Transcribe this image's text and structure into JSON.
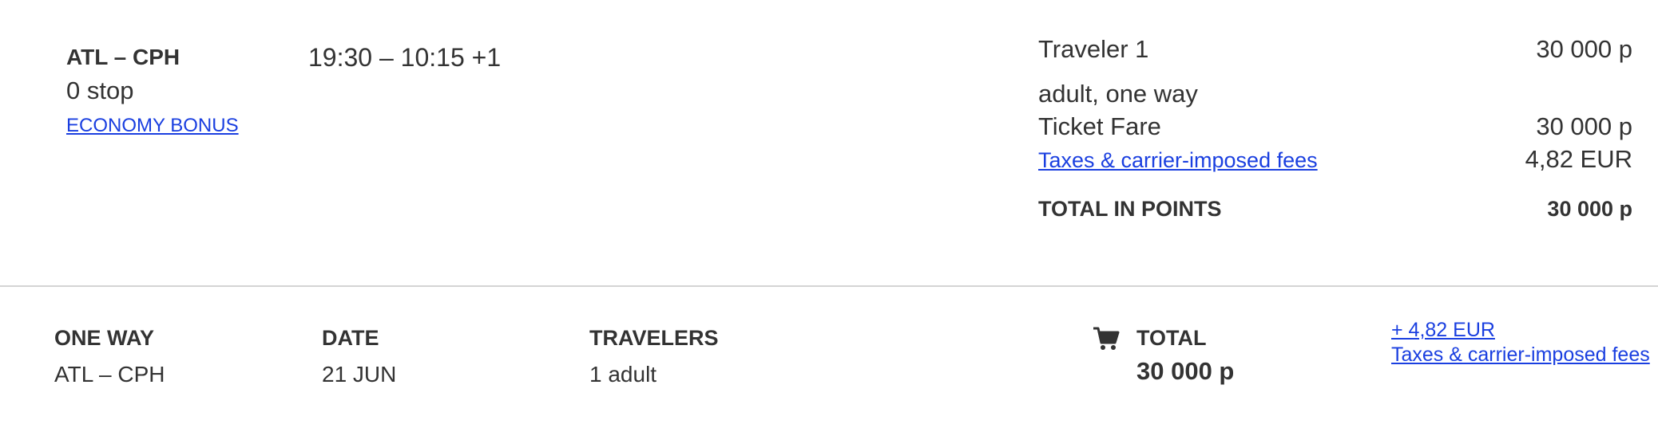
{
  "flight": {
    "route": "ATL – CPH",
    "stops": "0 stop",
    "fare_class": "ECONOMY BONUS",
    "times": "19:30 – 10:15 +1"
  },
  "price": {
    "traveler_label": "Traveler 1",
    "traveler_amount": "30 000 p",
    "passenger_type": "adult, one way",
    "ticket_fare_label": "Ticket Fare",
    "ticket_fare_amount": "30 000 p",
    "taxes_label": "Taxes & carrier-imposed fees",
    "taxes_amount": "4,82 EUR",
    "total_label": "TOTAL IN POINTS",
    "total_amount": "30 000 p"
  },
  "summary": {
    "trip_type_label": "ONE WAY",
    "trip_route": "ATL – CPH",
    "date_label": "DATE",
    "date_value": "21 JUN",
    "travelers_label": "TRAVELERS",
    "travelers_value": "1 adult",
    "cart_icon": "cart-icon",
    "total_label": "TOTAL",
    "total_value": "30 000 p",
    "fee_amount": "+ 4,82 EUR",
    "fee_label": "Taxes & carrier-imposed fees"
  },
  "colors": {
    "link": "#1a3fe0",
    "text": "#333333",
    "muted": "#777777",
    "divider": "#d4d4d4"
  }
}
